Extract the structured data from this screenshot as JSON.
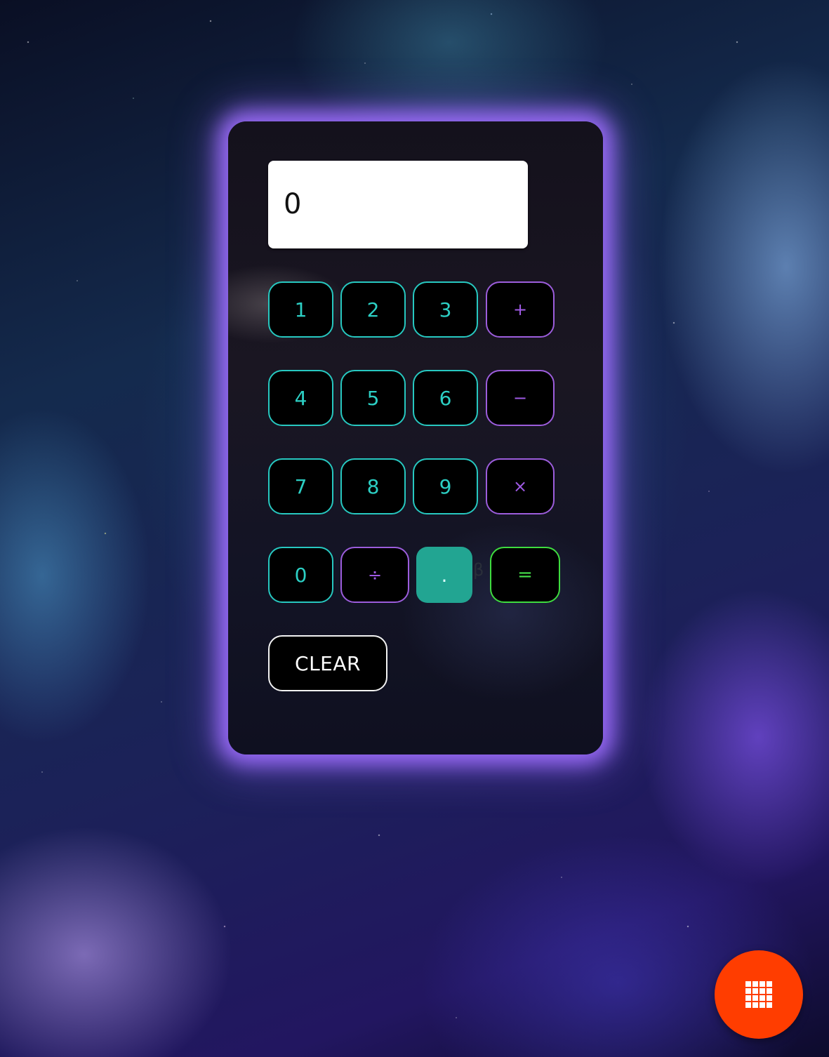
{
  "display": {
    "value": "0"
  },
  "keys": {
    "k1": "1",
    "k2": "2",
    "k3": "3",
    "add": "+",
    "k4": "4",
    "k5": "5",
    "k6": "6",
    "sub": "−",
    "k7": "7",
    "k8": "8",
    "k9": "9",
    "mul": "×",
    "k0": "0",
    "div": "÷",
    "dot": ".",
    "eq": "=",
    "clear": "CLEAR"
  },
  "stray_text": "β",
  "fab": {
    "icon": "grid-icon"
  },
  "colors": {
    "number_key": "#27c8c0",
    "operator_key": "#9c5ddc",
    "equals_key": "#3fdc3f",
    "dot_key": "#22a592",
    "panel_glow": "#a06eff",
    "fab": "#ff3d00"
  }
}
